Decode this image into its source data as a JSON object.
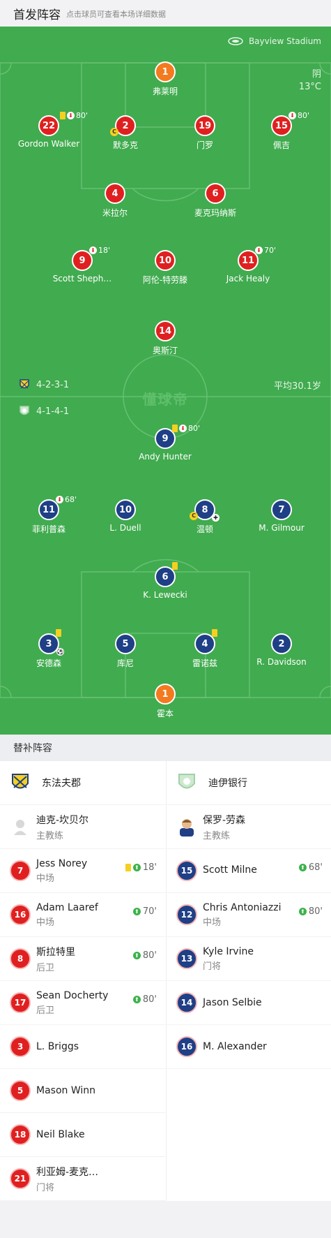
{
  "header": {
    "title": "首发阵容",
    "subtitle": "点击球员可查看本场详细数据"
  },
  "pitch": {
    "stadium": "Bayview Stadium",
    "weather": "阴",
    "temperature": "13°C",
    "home_formation": "4-2-3-1",
    "away_formation": "4-1-4-1",
    "avg_age": "平均30.1岁",
    "watermark": "懂球帝",
    "colors": {
      "grass": "#41ab4f",
      "home": "#e02020",
      "away": "#1f3f86",
      "keeper": "#f47a1f"
    }
  },
  "home_players": [
    {
      "num": "1",
      "name": "弗莱明",
      "keeper": true,
      "event": ""
    },
    {
      "num": "22",
      "name": "Gordon Walker",
      "event": "80'",
      "card": true,
      "subout": true
    },
    {
      "num": "2",
      "name": "默多克",
      "captain": true,
      "event": ""
    },
    {
      "num": "19",
      "name": "门罗",
      "event": ""
    },
    {
      "num": "15",
      "name": "佩吉",
      "event": "80'",
      "subout": true
    },
    {
      "num": "4",
      "name": "米拉尔",
      "event": ""
    },
    {
      "num": "6",
      "name": "麦克玛纳斯",
      "event": ""
    },
    {
      "num": "9",
      "name": "Scott Sheph…",
      "event": "18'",
      "subout": true
    },
    {
      "num": "10",
      "name": "阿伦-特劳滕",
      "event": ""
    },
    {
      "num": "11",
      "name": "Jack Healy",
      "event": "70'",
      "subout": true
    },
    {
      "num": "14",
      "name": "奥斯汀",
      "event": ""
    }
  ],
  "away_players": [
    {
      "num": "9",
      "name": "Andy Hunter",
      "event": "80'",
      "card": true,
      "subout": true
    },
    {
      "num": "11",
      "name": "菲利普森",
      "event": "68'",
      "subout": true
    },
    {
      "num": "10",
      "name": "L. Duell",
      "event": ""
    },
    {
      "num": "8",
      "name": "温顿",
      "captain": true,
      "event": ""
    },
    {
      "num": "7",
      "name": "M. Gilmour",
      "event": ""
    },
    {
      "num": "6",
      "name": "K. Lewecki",
      "card": true,
      "event": ""
    },
    {
      "num": "3",
      "name": "安德森",
      "card": true,
      "goal": true,
      "event": ""
    },
    {
      "num": "5",
      "name": "库尼",
      "event": ""
    },
    {
      "num": "4",
      "name": "雷诺兹",
      "card": true,
      "event": ""
    },
    {
      "num": "2",
      "name": "R. Davidson",
      "event": ""
    },
    {
      "num": "1",
      "name": "霍本",
      "keeper": true,
      "event": ""
    }
  ],
  "subs_title": "替补阵容",
  "home_team": {
    "name": "东法夫郡",
    "coach": "迪克-坎贝尔",
    "coach_role": "主教练"
  },
  "away_team": {
    "name": "迪伊银行",
    "coach": "保罗-劳森",
    "coach_role": "主教练"
  },
  "home_subs": [
    {
      "num": "7",
      "name": "Jess Norey",
      "pos": "中场",
      "in": "18'",
      "card": true
    },
    {
      "num": "16",
      "name": "Adam Laaref",
      "pos": "中场",
      "in": "70'"
    },
    {
      "num": "8",
      "name": "斯拉特里",
      "pos": "后卫",
      "in": "80'"
    },
    {
      "num": "17",
      "name": "Sean Docherty",
      "pos": "后卫",
      "in": "80'"
    },
    {
      "num": "3",
      "name": "L. Briggs",
      "pos": "",
      "in": ""
    },
    {
      "num": "5",
      "name": "Mason Winn",
      "pos": "",
      "in": ""
    },
    {
      "num": "18",
      "name": "Neil Blake",
      "pos": "",
      "in": ""
    },
    {
      "num": "21",
      "name": "利亚姆-麦克…",
      "pos": "门将",
      "in": ""
    }
  ],
  "away_subs": [
    {
      "num": "15",
      "name": "Scott Milne",
      "pos": "",
      "in": "68'"
    },
    {
      "num": "12",
      "name": "Chris Antoniazzi",
      "pos": "中场",
      "in": "80'"
    },
    {
      "num": "13",
      "name": "Kyle Irvine",
      "pos": "门将",
      "in": ""
    },
    {
      "num": "14",
      "name": "Jason Selbie",
      "pos": "",
      "in": ""
    },
    {
      "num": "16",
      "name": "M. Alexander",
      "pos": "",
      "in": ""
    }
  ]
}
